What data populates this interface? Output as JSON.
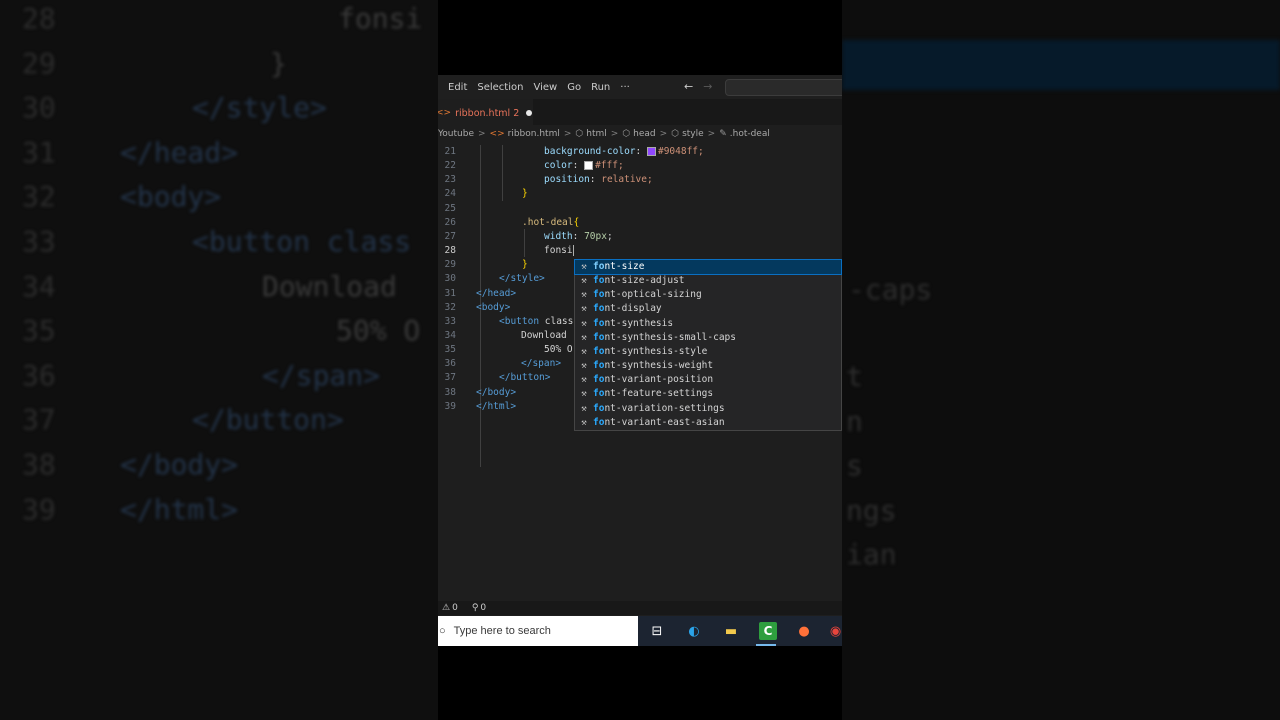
{
  "background": {
    "left_lines": [
      {
        "num": "28",
        "text": "fonsi"
      },
      {
        "num": "29",
        "text": "}"
      },
      {
        "num": "30",
        "text": "</style>"
      },
      {
        "num": "31",
        "text": "</head>"
      },
      {
        "num": "32",
        "text": "<body>"
      },
      {
        "num": "33",
        "text": "<button class"
      },
      {
        "num": "34",
        "text": "Download"
      },
      {
        "num": "35",
        "text": "50% O"
      },
      {
        "num": "36",
        "text": "</span>"
      },
      {
        "num": "37",
        "text": "</button>"
      },
      {
        "num": "38",
        "text": "</body>"
      },
      {
        "num": "39",
        "text": "</html>"
      }
    ],
    "right_lines": [
      "-caps",
      "t",
      "n",
      "s",
      "ngs",
      "ian"
    ]
  },
  "menu": {
    "items": [
      "Edit",
      "Selection",
      "View",
      "Go",
      "Run",
      "···"
    ],
    "back_arrow": "←",
    "forward_arrow": "→"
  },
  "tab": {
    "icon": "<>",
    "label": "ribbon.html",
    "problems": "2"
  },
  "breadcrumb": {
    "items": [
      {
        "icon": "",
        "label": "Youtube"
      },
      {
        "icon": "<>",
        "label": "ribbon.html"
      },
      {
        "icon": "⬡",
        "label": "html"
      },
      {
        "icon": "⬡",
        "label": "head"
      },
      {
        "icon": "⬡",
        "label": "style"
      },
      {
        "icon": "✎",
        "label": ".hot-deal"
      }
    ]
  },
  "editor": {
    "active_line": "28",
    "lines": [
      {
        "n": "21",
        "prop": "background-color",
        "swatch": "#9048ff",
        "val": "#9048ff;"
      },
      {
        "n": "22",
        "prop": "color",
        "swatch": "#ffffff",
        "val": "#fff;"
      },
      {
        "n": "23",
        "prop": "position",
        "val": "relative;"
      },
      {
        "n": "24",
        "brace": "}"
      },
      {
        "n": "25"
      },
      {
        "n": "26",
        "sel": ".hot-deal",
        "brace": "{"
      },
      {
        "n": "27",
        "prop": "width",
        "num": "70px",
        "tail": ";"
      },
      {
        "n": "28",
        "typed": "fonsi"
      },
      {
        "n": "29",
        "brace": "}"
      },
      {
        "n": "30",
        "tag": "</style>"
      },
      {
        "n": "31",
        "tag": "</head>"
      },
      {
        "n": "32",
        "tag": "<body>"
      },
      {
        "n": "33",
        "tag": "<button ",
        "text": "class"
      },
      {
        "n": "34",
        "text": "Download"
      },
      {
        "n": "35",
        "text": "50% O"
      },
      {
        "n": "36",
        "tag": "</span>"
      },
      {
        "n": "37",
        "tag": "</button>"
      },
      {
        "n": "38",
        "tag": "</body>"
      },
      {
        "n": "39",
        "tag": "</html>"
      }
    ]
  },
  "suggestions": [
    {
      "label": "font-size",
      "selected": true
    },
    {
      "label": "font-size-adjust"
    },
    {
      "label": "font-optical-sizing"
    },
    {
      "label": "font-display"
    },
    {
      "label": "font-synthesis"
    },
    {
      "label": "font-synthesis-small-caps"
    },
    {
      "label": "font-synthesis-style"
    },
    {
      "label": "font-synthesis-weight"
    },
    {
      "label": "font-variant-position"
    },
    {
      "label": "font-feature-settings"
    },
    {
      "label": "font-variation-settings"
    },
    {
      "label": "font-variant-east-asian"
    }
  ],
  "status": {
    "errors": "0",
    "warnings": "0"
  },
  "taskbar": {
    "search_placeholder": "Type here to search",
    "icons": [
      {
        "name": "task-view-icon",
        "glyph": "⊟",
        "color": "#ffffff"
      },
      {
        "name": "edge-icon",
        "glyph": "◐",
        "color": "#2ba3e8"
      },
      {
        "name": "file-explorer-icon",
        "glyph": "▬",
        "color": "#f2c94c"
      },
      {
        "name": "camtasia-icon",
        "glyph": "C",
        "color": "#ffffff"
      },
      {
        "name": "firefox-icon",
        "glyph": "●",
        "color": "#ff7139"
      },
      {
        "name": "chrome-icon",
        "glyph": "◉",
        "color": "#e8453c"
      }
    ]
  }
}
